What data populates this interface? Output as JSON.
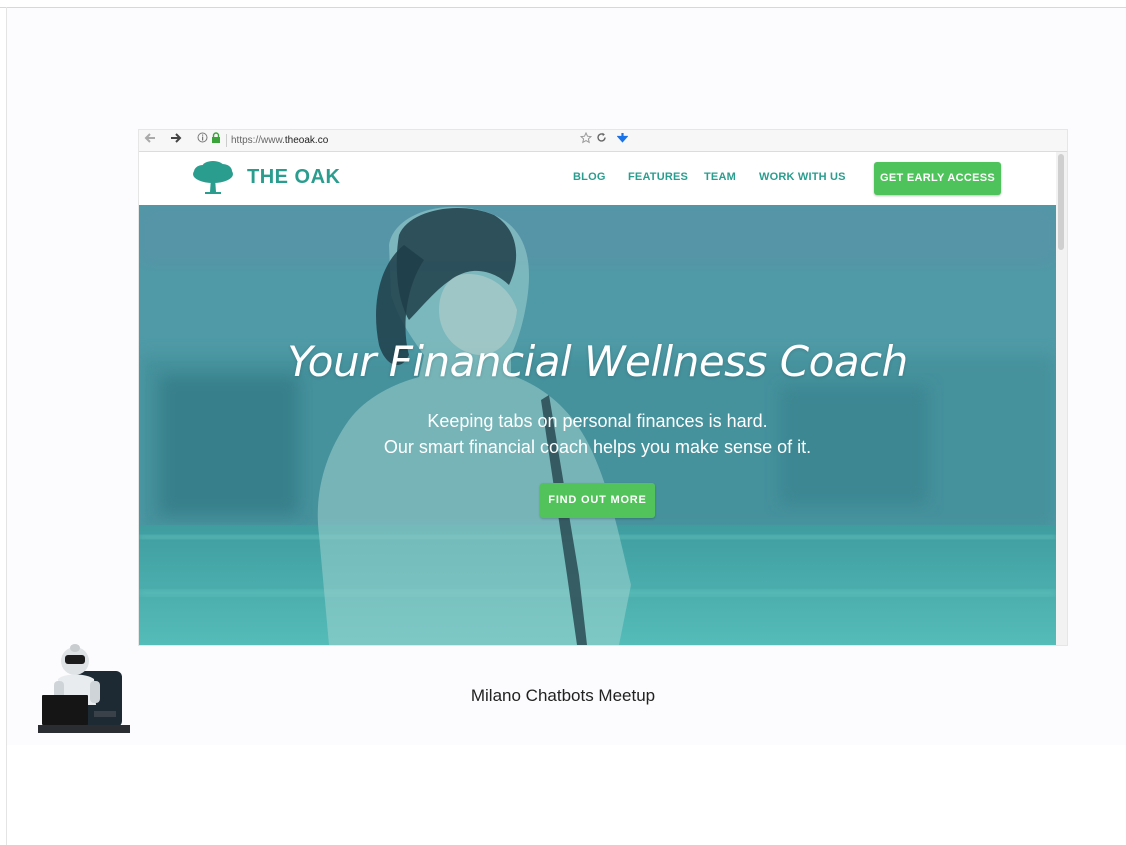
{
  "browser": {
    "url_prefix": "https://www.",
    "url_domain": "theoak.co",
    "icons": [
      "back-arrow-icon",
      "forward-arrow-icon",
      "info-icon",
      "lock-icon",
      "star-icon",
      "reload-icon",
      "download-icon"
    ]
  },
  "site": {
    "brand": "THE OAK",
    "nav": [
      "BLOG",
      "FEATURES",
      "TEAM",
      "WORK WITH US"
    ],
    "cta_top": "GET EARLY ACCESS",
    "hero": {
      "title": "Your Financial Wellness Coach",
      "line1": "Keeping tabs on personal finances is hard.",
      "line2": "Our smart financial coach helps you make sense of it.",
      "button": "FIND OUT MORE"
    },
    "colors": {
      "brand_teal": "#2a9d8f",
      "button_green": "#4fc35b",
      "hero_overlay": "#46a6aa"
    }
  },
  "slide": {
    "caption": "Milano Chatbots Meetup",
    "mascot": "robot-with-laptop"
  }
}
